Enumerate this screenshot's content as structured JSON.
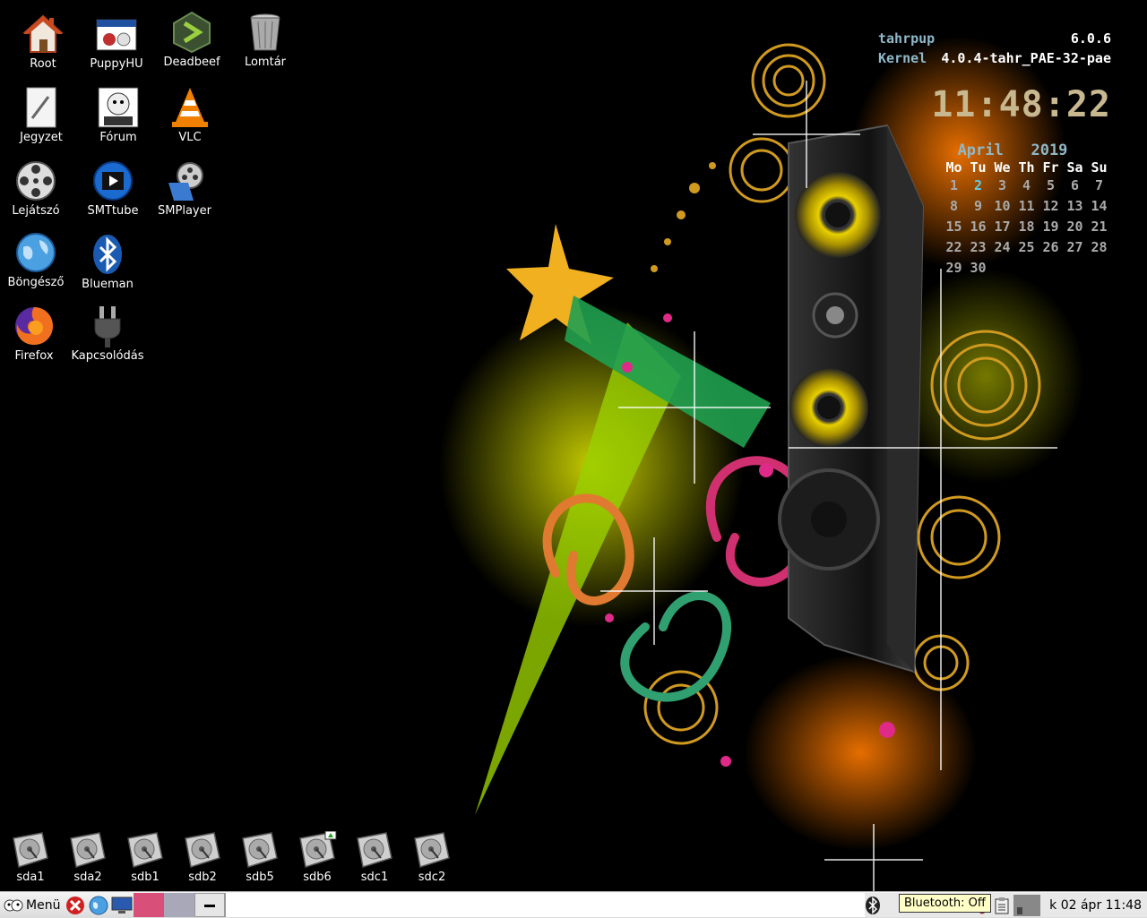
{
  "desktop_icons": [
    {
      "label": "Root",
      "icon": "home-icon"
    },
    {
      "label": "PuppyHU",
      "icon": "puppyhu-icon"
    },
    {
      "label": "Deadbeef",
      "icon": "deadbeef-icon"
    },
    {
      "label": "Lomtár",
      "icon": "trash-icon"
    },
    {
      "label": "Jegyzet",
      "icon": "notepad-icon"
    },
    {
      "label": "Fórum",
      "icon": "puppy-forum-icon"
    },
    {
      "label": "VLC",
      "icon": "vlc-icon"
    },
    {
      "label": "Lejátszó",
      "icon": "film-reel-icon"
    },
    {
      "label": "SMTtube",
      "icon": "smtube-icon"
    },
    {
      "label": "SMPlayer",
      "icon": "smplayer-icon"
    },
    {
      "label": "Böngésző",
      "icon": "globe-icon"
    },
    {
      "label": "Blueman",
      "icon": "bluetooth-icon"
    },
    {
      "label": "Firefox",
      "icon": "firefox-icon"
    },
    {
      "label": "Kapcsolódás",
      "icon": "plug-icon"
    }
  ],
  "drives": [
    "sda1",
    "sda2",
    "sdb1",
    "sdb2",
    "sdb5",
    "sdb6",
    "sdc1",
    "sdc2"
  ],
  "conky": {
    "distro_label": "tahrpup",
    "distro_version": "6.0.6",
    "kernel_label": "Kernel",
    "kernel_version": "4.0.4-tahr_PAE-32-pae",
    "time": "11:48:22"
  },
  "calendar": {
    "month": "April",
    "year": "2019",
    "days": [
      "Mo",
      "Tu",
      "We",
      "Th",
      "Fr",
      "Sa",
      "Su"
    ],
    "weeks": [
      [
        "1",
        "2",
        "3",
        "4",
        "5",
        "6",
        "7"
      ],
      [
        "8",
        "9",
        "10",
        "11",
        "12",
        "13",
        "14"
      ],
      [
        "15",
        "16",
        "17",
        "18",
        "19",
        "20",
        "21"
      ],
      [
        "22",
        "23",
        "24",
        "25",
        "26",
        "27",
        "28"
      ],
      [
        "29",
        "30",
        "",
        "",
        "",
        "",
        ""
      ]
    ],
    "today": "2"
  },
  "taskbar": {
    "menu_label": "Menü",
    "bluetooth_tooltip": "Bluetooth: Off",
    "clock": "k 02 ápr 11:48"
  },
  "colors": {
    "clock": "#c8b890",
    "accent_blue": "#8fb8c8",
    "today": "#5fd0e0",
    "workspace_active": "#d8507a"
  }
}
